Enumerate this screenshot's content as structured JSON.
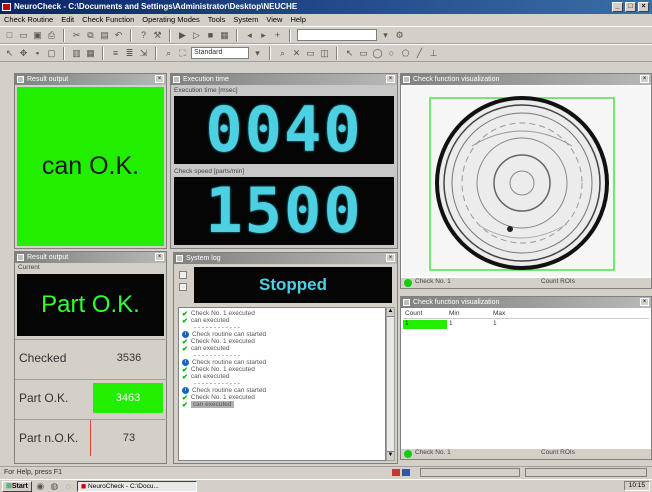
{
  "window": {
    "title": "NeuroCheck - C:\\Documents and Settings\\Administrator\\Desktop\\NEUCHE"
  },
  "menu": [
    "Check Routine",
    "Edit",
    "Check Function",
    "Operating Modes",
    "Tools",
    "System",
    "View",
    "Help"
  ],
  "toolbar": {
    "zoom_value": "Standard"
  },
  "panels": {
    "result1": {
      "title": "Result output",
      "text": "can O.K.",
      "color": "#22ee00"
    },
    "execution": {
      "title": "Execution time",
      "label1": "Execution time [msec]",
      "value1": "0040",
      "label2": "Check speed [parts/min]",
      "value2": "1500"
    },
    "visual1": {
      "title": "Check function visualization",
      "status_left": "Check No. 1",
      "status_right": "Count ROIs"
    },
    "result2": {
      "title": "Result output",
      "sublabel": "Current",
      "text": "Part O.K.",
      "rows": [
        {
          "label": "Checked",
          "value": "3536"
        },
        {
          "label": "Part O.K.",
          "value": "3463"
        },
        {
          "label": "Part n.O.K.",
          "value": "73"
        }
      ]
    },
    "syslog": {
      "title": "System log",
      "status": "Stopped",
      "entries": [
        {
          "icon": "check",
          "text": "Check No. 1 executed"
        },
        {
          "icon": "check",
          "text": "can executed"
        },
        {
          "icon": "none",
          "text": "- - - - - - - - - - - -"
        },
        {
          "icon": "info",
          "text": "Check routine can started"
        },
        {
          "icon": "check",
          "text": "Check No. 1 executed"
        },
        {
          "icon": "check",
          "text": "can executed"
        },
        {
          "icon": "none",
          "text": "- - - - - - - - - - - -"
        },
        {
          "icon": "info",
          "text": "Check routine can started"
        },
        {
          "icon": "check",
          "text": "Check No. 1 executed"
        },
        {
          "icon": "check",
          "text": "can executed"
        },
        {
          "icon": "none",
          "text": "- - - - - - - - - - - -"
        },
        {
          "icon": "info",
          "text": "Check routine can started"
        },
        {
          "icon": "check",
          "text": "Check No. 1 executed"
        },
        {
          "icon": "check",
          "text": "can executed"
        }
      ]
    },
    "visual2": {
      "title": "Check function visualization",
      "columns": [
        "Count",
        "Min",
        "Max"
      ],
      "row": [
        "1",
        "1",
        "1"
      ],
      "status_left": "Check No. 1",
      "status_right": "Count ROIs"
    }
  },
  "statusbar": {
    "text": "For Help, press F1"
  },
  "taskbar": {
    "start": "Start",
    "task": "NeuroCheck - C:\\Docu...",
    "clock": "10:15"
  }
}
